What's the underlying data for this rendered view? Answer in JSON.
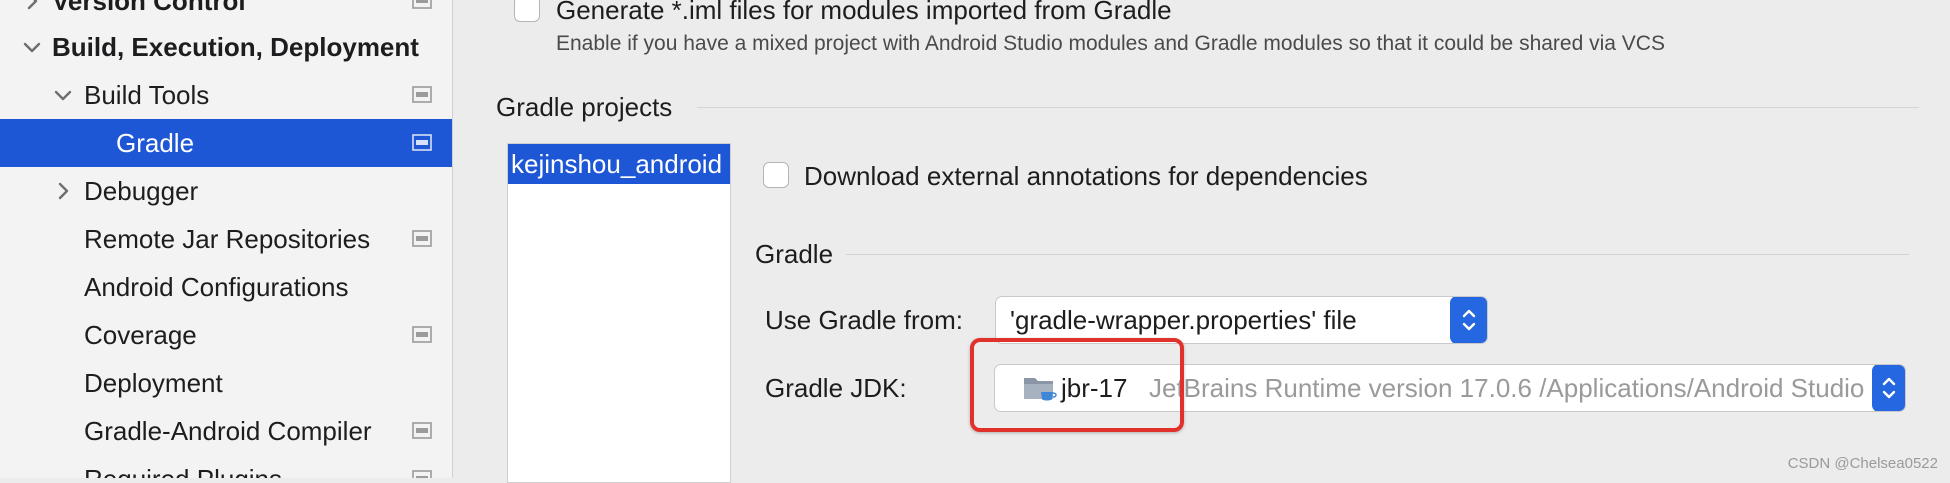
{
  "sidebar": {
    "items": [
      {
        "label": "Version Control",
        "bold": true,
        "chevron": "chevron-right",
        "project_icon": true
      },
      {
        "label": "Build, Execution, Deployment",
        "bold": true,
        "chevron": "chevron-down",
        "project_icon": false
      },
      {
        "label": "Build Tools",
        "bold": false,
        "chevron": "chevron-down",
        "project_icon": true
      },
      {
        "label": "Gradle",
        "bold": false,
        "chevron": "",
        "project_icon": true,
        "selected": true
      },
      {
        "label": "Debugger",
        "bold": false,
        "chevron": "chevron-right",
        "project_icon": false
      },
      {
        "label": "Remote Jar Repositories",
        "bold": false,
        "chevron": "",
        "project_icon": true
      },
      {
        "label": "Android Configurations",
        "bold": false,
        "chevron": "",
        "project_icon": false
      },
      {
        "label": "Coverage",
        "bold": false,
        "chevron": "",
        "project_icon": true
      },
      {
        "label": "Deployment",
        "bold": false,
        "chevron": "",
        "project_icon": false
      },
      {
        "label": "Gradle-Android Compiler",
        "bold": false,
        "chevron": "",
        "project_icon": true
      },
      {
        "label": "Required Plugins",
        "bold": false,
        "chevron": "",
        "project_icon": true
      }
    ]
  },
  "main": {
    "generate_iml": {
      "label": "Generate *.iml files for modules imported from Gradle",
      "description": "Enable if you have a mixed project with Android Studio modules and Gradle modules so that it could be shared via VCS",
      "checked": false
    },
    "gradle_projects": {
      "title": "Gradle projects",
      "items": [
        "kejinshou_android"
      ]
    },
    "download_annotations": {
      "label": "Download external annotations for dependencies",
      "checked": false
    },
    "gradle_section": {
      "title": "Gradle",
      "use_gradle_from": {
        "label": "Use Gradle from:",
        "value": "'gradle-wrapper.properties' file"
      },
      "gradle_jdk": {
        "label": "Gradle JDK:",
        "name": "jbr-17",
        "detail": "JetBrains Runtime version 17.0.6 /Applications/Android Studio"
      }
    }
  },
  "watermark": "CSDN @Chelsea0522",
  "colors": {
    "accent": "#1e57d6",
    "select_button": "#2467e0",
    "highlight": "#e0322a",
    "background": "#ececec",
    "sidebar_background": "#f3f3f3"
  }
}
